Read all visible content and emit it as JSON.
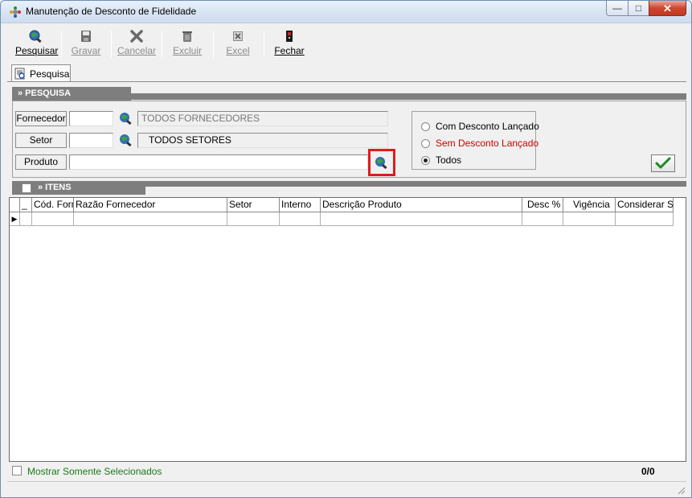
{
  "window": {
    "title": "Manutenção de Desconto de Fidelidade",
    "min_glyph": "—",
    "max_glyph": "□",
    "close_glyph": "✕"
  },
  "toolbar": {
    "pesquisar": "Pesquisar",
    "gravar": "Gravar",
    "cancelar": "Cancelar",
    "excluir": "Excluir",
    "excel": "Excel",
    "fechar": "Fechar"
  },
  "tabs": [
    {
      "label": "Pesquisa"
    }
  ],
  "pesquisa": {
    "header": "» PESQUISA",
    "fornecedor": {
      "label": "Fornecedor",
      "code": "",
      "name": "TODOS FORNECEDORES"
    },
    "setor": {
      "label": "Setor",
      "code": "",
      "name": "TODOS SETORES"
    },
    "produto": {
      "label": "Produto",
      "value": ""
    },
    "radios": [
      {
        "label": "Com Desconto Lançado",
        "color": "#000000",
        "selected": false
      },
      {
        "label": "Sem Desconto Lançado",
        "color": "#cc0000",
        "selected": false
      },
      {
        "label": "Todos",
        "color": "#000000",
        "selected": true
      }
    ]
  },
  "itens": {
    "header": "» ITENS",
    "columns": [
      "_",
      "Cód. Forn",
      "Razão Fornecedor",
      "Setor",
      "Interno",
      "Descrição Produto",
      "Desc %",
      "Vigência",
      "Considerar ST"
    ],
    "row_marker": "▶"
  },
  "footer": {
    "mostrar_label": "Mostrar Somente Selecionados",
    "count": "0/0"
  },
  "colors": {
    "accent_green": "#1a7a1a",
    "header_grey": "#7e7e7e",
    "highlight_red": "#e01b1b"
  }
}
